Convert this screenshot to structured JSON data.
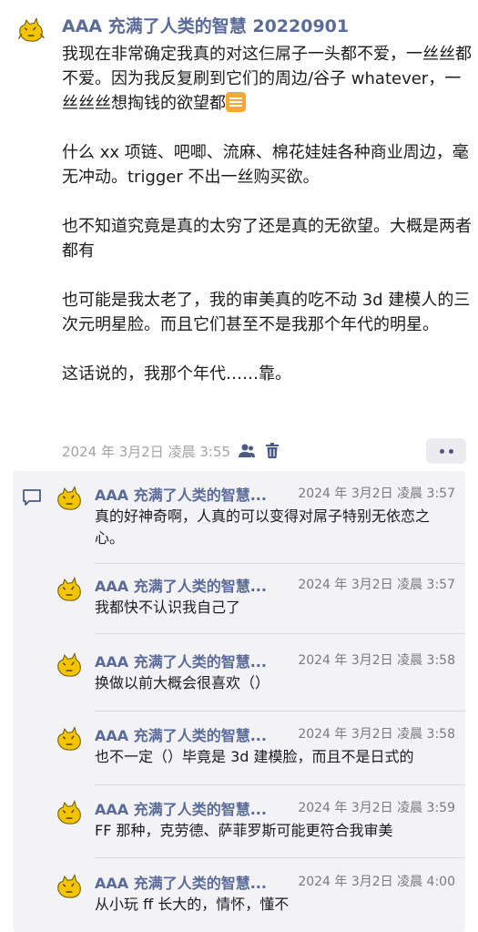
{
  "post": {
    "author": "AAA 充满了人类的智慧 20220901",
    "paragraphs": [
      "我现在非常确定我真的对这仨屌子一头都不爱，一丝丝都不爱。因为我反复刷到它们的周边/谷子 whatever，一丝丝丝想掏钱的欲望都",
      "什么 xx 项链、吧唧、流麻、棉花娃娃各种商业周边，毫无冲动。trigger 不出一丝购买欲。",
      "也不知道究竟是真的太穷了还是真的无欲望。大概是两者都有",
      "也可能是我太老了，我的审美真的吃不动 3d 建模人的三次元明星脸。而且它们甚至不是我那个年代的明星。",
      "这话说的，我那个年代……靠。"
    ],
    "time": "2024 年 3月2日 凌晨 3:55",
    "icons": [
      "people-icon",
      "trash-icon",
      "more-icon"
    ]
  },
  "comments": [
    {
      "author": "AAA 充满了人类的智慧...",
      "time": "2024 年 3月2日 凌晨 3:57",
      "text": "真的好神奇啊，人真的可以变得对屌子特别无依恋之心。"
    },
    {
      "author": "AAA 充满了人类的智慧...",
      "time": "2024 年 3月2日 凌晨 3:57",
      "text": "我都快不认识我自己了"
    },
    {
      "author": "AAA 充满了人类的智慧...",
      "time": "2024 年 3月2日 凌晨 3:58",
      "text": "换做以前大概会很喜欢（）"
    },
    {
      "author": "AAA 充满了人类的智慧...",
      "time": "2024 年 3月2日 凌晨 3:58",
      "text": "也不一定（）毕竟是 3d 建模脸，而且不是日式的"
    },
    {
      "author": "AAA 充满了人类的智慧...",
      "time": "2024 年 3月2日 凌晨 3:59",
      "text": "FF 那种，克劳德、萨菲罗斯可能更符合我审美"
    },
    {
      "author": "AAA 充满了人类的智慧...",
      "time": "2024 年 3月2日 凌晨 4:00",
      "text": "从小玩 ff 长大的，情怀，懂不"
    }
  ],
  "colors": {
    "author": "#5a6b9a",
    "meta": "#a3a3a8",
    "panel": "#f3f3f5",
    "accent": "#4a5a85"
  }
}
